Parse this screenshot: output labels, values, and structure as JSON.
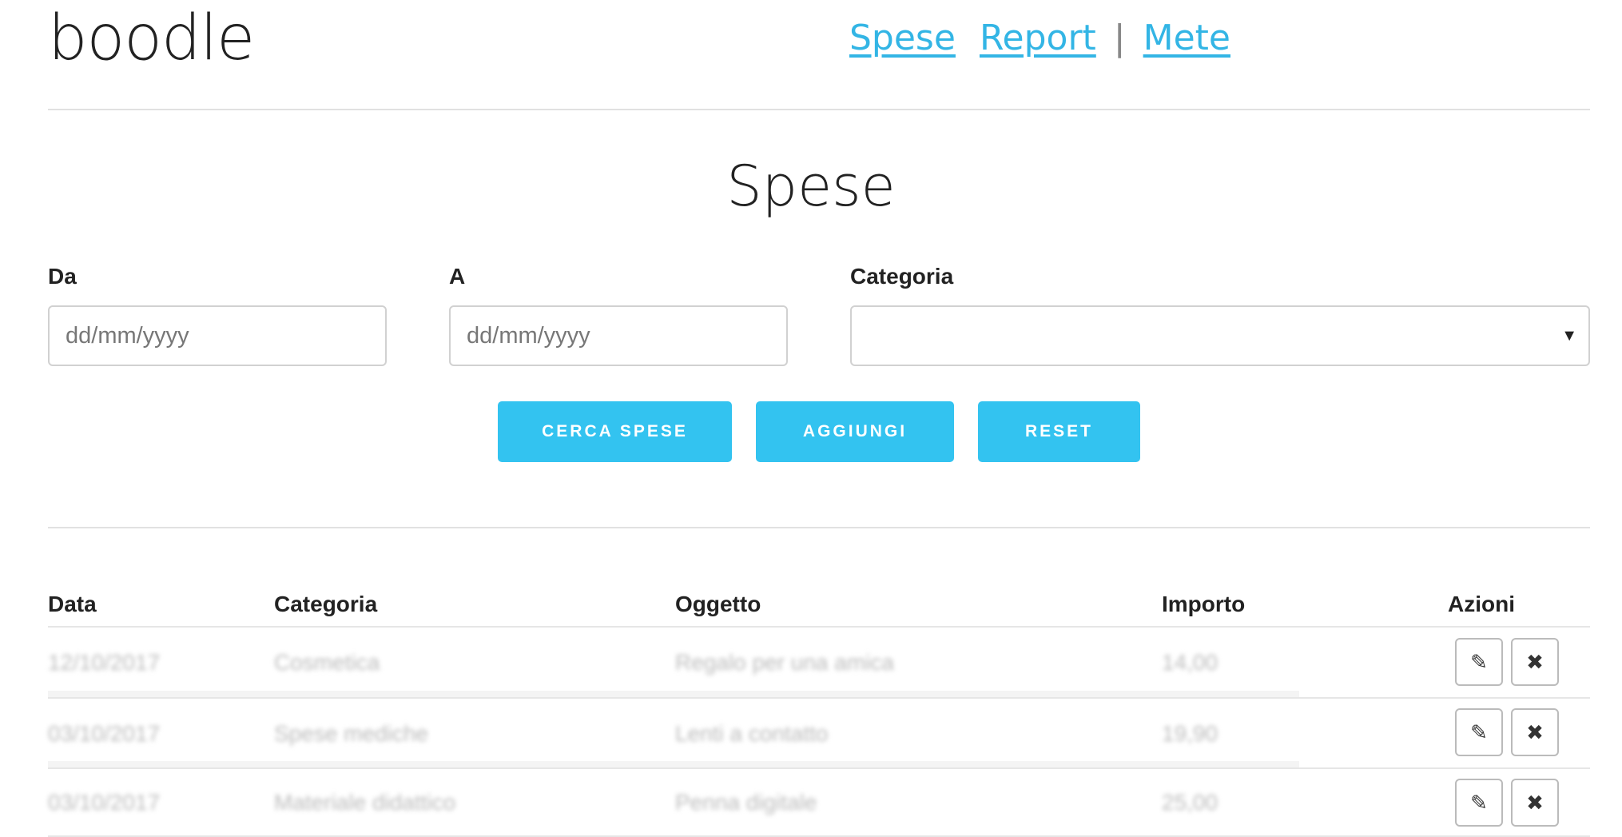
{
  "header": {
    "brand": "boodle",
    "nav": {
      "spese": "Spese",
      "report": "Report",
      "separator": "|",
      "mete": "Mete"
    }
  },
  "page": {
    "title": "Spese"
  },
  "filters": {
    "from_label": "Da",
    "from_placeholder": "dd/mm/yyyy",
    "to_label": "A",
    "to_placeholder": "dd/mm/yyyy",
    "category_label": "Categoria",
    "category_value": ""
  },
  "buttons": {
    "search": "CERCA SPESE",
    "add": "AGGIUNGI",
    "reset": "RESET"
  },
  "table": {
    "headers": [
      "Data",
      "Categoria",
      "Oggetto",
      "Importo",
      "Azioni"
    ],
    "rows": [
      {
        "data": "12/10/2017",
        "categoria": "Cosmetica",
        "oggetto": "Regalo per una amica",
        "importo": "14,00"
      },
      {
        "data": "03/10/2017",
        "categoria": "Spese mediche",
        "oggetto": "Lenti a contatto",
        "importo": "19,90"
      },
      {
        "data": "03/10/2017",
        "categoria": "Materiale didattico",
        "oggetto": "Penna digitale",
        "importo": "25,00"
      }
    ]
  },
  "icons": {
    "edit": "pencil-icon",
    "delete": "close-icon"
  },
  "colors": {
    "accent": "#33c3f0",
    "link": "#33b5e5"
  }
}
